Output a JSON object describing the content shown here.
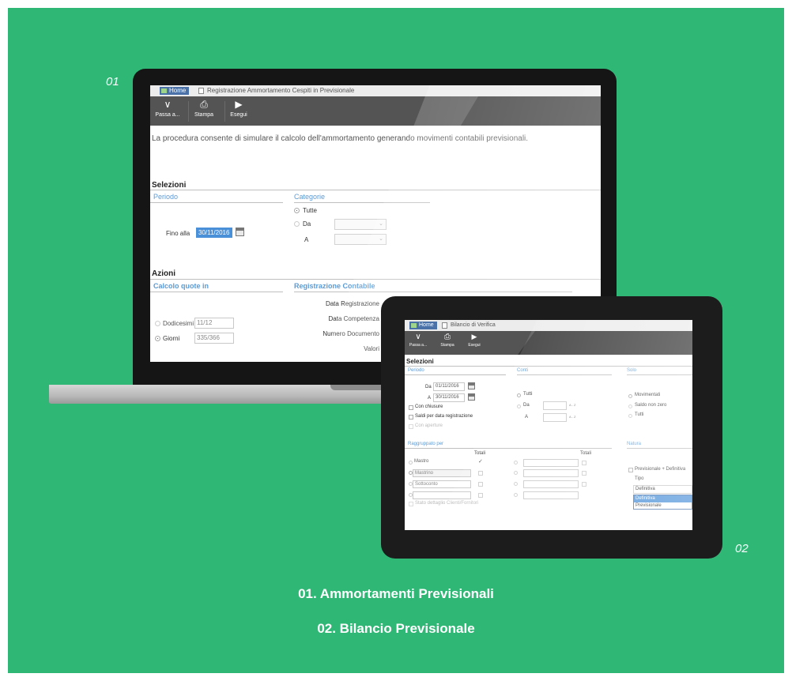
{
  "colors": {
    "background": "#2fb775",
    "selection": "#4a90d9",
    "section_blue": "#5b9bd5"
  },
  "labels": {
    "first_index": "01",
    "second_index": "02"
  },
  "captions": [
    "01. Ammortamenti Previsionali",
    "02. Bilancio Previsionale"
  ],
  "screen1": {
    "tabs": {
      "home": "Home",
      "document": "Registrazione Ammortamento Cespiti in Previsionale"
    },
    "toolbar": [
      {
        "label": "Passa a...",
        "icon": "double-chevron-down-icon"
      },
      {
        "label": "Stampa",
        "icon": "printer-icon"
      },
      {
        "label": "Esegui",
        "icon": "play-icon"
      }
    ],
    "description": "La procedura consente di simulare il calcolo dell'ammortamento generando movimenti contabili previsionali.",
    "selezioni": {
      "title": "Selezioni",
      "periodo": {
        "title": "Periodo",
        "fino_label": "Fino alla",
        "fino_value": "30/11/2016"
      },
      "categorie": {
        "title": "Categorie",
        "tutte": "Tutte",
        "da": "Da",
        "a": "A"
      }
    },
    "azioni": {
      "title": "Azioni",
      "calcolo": {
        "title": "Calcolo quote in",
        "dodicesimi_label": "Dodicesimi",
        "dodicesimi_value": "11/12",
        "giorni_label": "Giorni",
        "giorni_value": "335/366"
      },
      "registrazione": {
        "title": "Registrazione Contabile",
        "data_registrazione": "Data Registrazione",
        "data_competenza": "Data Competenza",
        "numero_documento": "Numero Documento",
        "valori": "Valori"
      }
    }
  },
  "screen2": {
    "tabs": {
      "home": "Home",
      "document": "Bilancio di Verifica"
    },
    "toolbar": [
      {
        "label": "Passa a...",
        "icon": "double-chevron-down-icon"
      },
      {
        "label": "Stampa",
        "icon": "printer-icon"
      },
      {
        "label": "Esegui",
        "icon": "play-icon"
      }
    ],
    "selezioni": "Selezioni",
    "periodo": {
      "title": "Periodo",
      "da_label": "Da",
      "da_value": "01/11/2016",
      "a_label": "A",
      "a_value": "30/11/2016",
      "con_chiusure": "Con chiusure",
      "saldi": "Saldi per data registrazione",
      "con_aperture": "Con aperture"
    },
    "conti": {
      "title": "Conti",
      "tutti": "Tutti",
      "da": "Da",
      "a": "A",
      "az": "A - Z"
    },
    "solo": {
      "title": "Solo",
      "movimentati": "Movimentati",
      "saldo_non_zero": "Saldo non zero",
      "tutti": "Tutti"
    },
    "raggruppato": {
      "title": "Raggruppato per",
      "totali": "Totali",
      "mastro": "Mastro",
      "mastrino": "Mastrino",
      "sottoconto": "Sottoconto",
      "stato_dettaglio": "Stato dettaglio Clienti/Fornitori"
    },
    "natura": {
      "title": "Natura",
      "previsionale_definitiva": "Previsionale + Definitiva",
      "tipo_label": "Tipo",
      "tipo_value": "Definitiva",
      "options": [
        "Definitiva",
        "Previsionale"
      ]
    }
  }
}
